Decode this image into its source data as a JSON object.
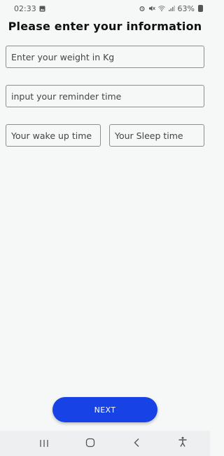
{
  "status_bar": {
    "time": "02:33",
    "battery_percent": "63%"
  },
  "header": {
    "title": "Please enter your information"
  },
  "form": {
    "weight_placeholder": "Enter your weight in Kg",
    "reminder_placeholder": "input your reminder time",
    "wake_placeholder": "Your wake up time",
    "sleep_placeholder": "Your Sleep time"
  },
  "actions": {
    "next_label": "NEXT"
  },
  "colors": {
    "accent": "#1742e6",
    "background": "#f6f8f7"
  },
  "icons": {
    "status_left": [
      "image-icon"
    ],
    "status_right": [
      "alarm-icon",
      "mute-icon",
      "wifi-icon",
      "signal-icon",
      "battery-icon"
    ],
    "nav": [
      "recent-apps-icon",
      "home-icon",
      "back-icon",
      "accessibility-icon"
    ]
  }
}
